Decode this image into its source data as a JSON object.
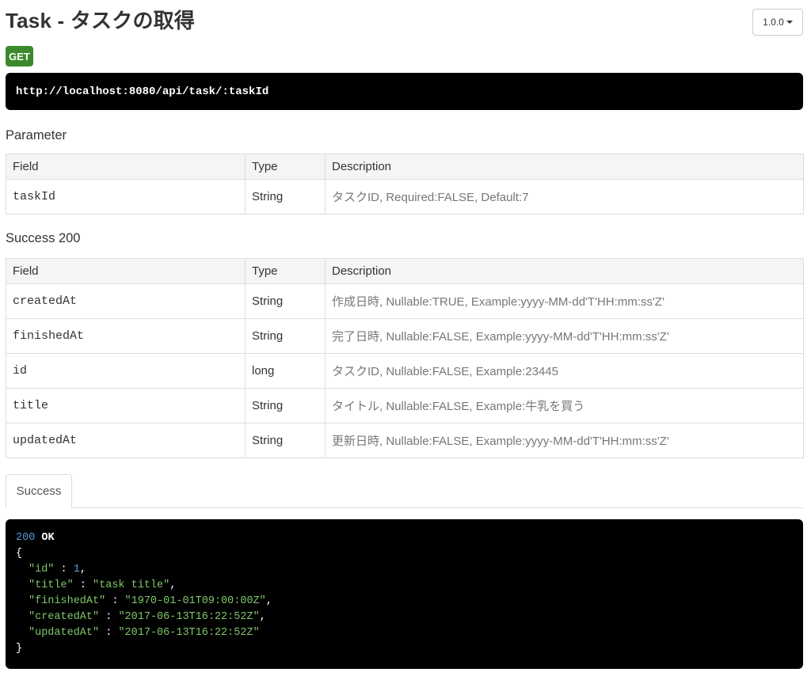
{
  "page": {
    "title": "Task - タスクの取得",
    "version": "1.0.0"
  },
  "endpoint": {
    "method": "GET",
    "url": "http://localhost:8080/api/task/:taskId"
  },
  "parameter": {
    "title": "Parameter",
    "headers": {
      "field": "Field",
      "type": "Type",
      "description": "Description"
    },
    "rows": [
      {
        "field": "taskId",
        "type": "String",
        "description": "タスクID, Required:FALSE, Default:7"
      }
    ]
  },
  "success": {
    "title": "Success 200",
    "headers": {
      "field": "Field",
      "type": "Type",
      "description": "Description"
    },
    "rows": [
      {
        "field": "createdAt",
        "type": "String",
        "description": "作成日時, Nullable:TRUE, Example:yyyy-MM-dd'T'HH:mm:ss'Z'"
      },
      {
        "field": "finishedAt",
        "type": "String",
        "description": "完了日時, Nullable:FALSE, Example:yyyy-MM-dd'T'HH:mm:ss'Z'"
      },
      {
        "field": "id",
        "type": "long",
        "description": "タスクID, Nullable:FALSE, Example:23445"
      },
      {
        "field": "title",
        "type": "String",
        "description": "タイトル, Nullable:FALSE, Example:牛乳を買う"
      },
      {
        "field": "updatedAt",
        "type": "String",
        "description": "更新日時, Nullable:FALSE, Example:yyyy-MM-dd'T'HH:mm:ss'Z'"
      }
    ]
  },
  "example_tabs": [
    "Success"
  ],
  "response_example": {
    "status_code": "200",
    "status_text": "OK",
    "open_brace": "{",
    "close_brace": "}",
    "entries": [
      {
        "key": "\"id\"",
        "value": "1",
        "value_type": "number",
        "trailing": ","
      },
      {
        "key": "\"title\"",
        "value": "\"task title\"",
        "value_type": "string",
        "trailing": ","
      },
      {
        "key": "\"finishedAt\"",
        "value": "\"1970-01-01T09:00:00Z\"",
        "value_type": "string",
        "trailing": ","
      },
      {
        "key": "\"createdAt\"",
        "value": "\"2017-06-13T16:22:52Z\"",
        "value_type": "string",
        "trailing": ","
      },
      {
        "key": "\"updatedAt\"",
        "value": "\"2017-06-13T16:22:52Z\"",
        "value_type": "string",
        "trailing": ""
      }
    ]
  },
  "colors": {
    "method_badge": "#3c8a2c",
    "code_background": "#000000",
    "json_number": "#5b9bd5",
    "json_string": "#7ec86b"
  }
}
